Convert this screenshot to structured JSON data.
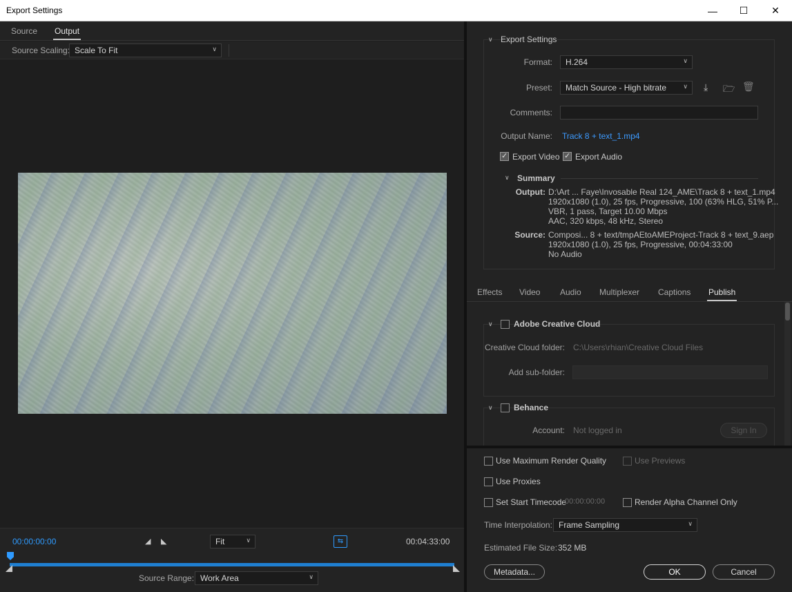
{
  "window": {
    "title": "Export Settings",
    "minimize": "—",
    "maximize": "☐",
    "close": "✕"
  },
  "left": {
    "tabs": [
      {
        "label": "Source"
      },
      {
        "label": "Output"
      }
    ],
    "source_scaling": {
      "label": "Source Scaling:",
      "value": "Scale To Fit"
    },
    "transport": {
      "current_time": "00:00:00:00",
      "end_time": "00:04:33:00",
      "zoom": "Fit",
      "source_range_label": "Source Range:",
      "source_range_value": "Work Area"
    }
  },
  "export_settings": {
    "section_title": "Export Settings",
    "format_label": "Format:",
    "format_value": "H.264",
    "preset_label": "Preset:",
    "preset_value": "Match Source - High bitrate",
    "comments_label": "Comments:",
    "comments_value": "",
    "output_name_label": "Output Name:",
    "output_name_value": "Track 8 + text_1.mp4",
    "export_video_label": "Export Video",
    "export_audio_label": "Export Audio",
    "summary": {
      "title": "Summary",
      "output_label": "Output:",
      "output_lines": [
        "D:\\Art ... Faye\\Invosable Real 124_AME\\Track 8 + text_1.mp4",
        "1920x1080 (1.0), 25 fps, Progressive, 100 (63% HLG, 51% P...",
        "VBR, 1 pass, Target 10.00 Mbps",
        "AAC, 320 kbps, 48 kHz, Stereo"
      ],
      "source_label": "Source:",
      "source_lines": [
        "Composi... 8 + text/tmpAEtoAMEProject-Track 8 + text_9.aep",
        "1920x1080 (1.0), 25 fps, Progressive, 00:04:33:00",
        "No Audio"
      ]
    }
  },
  "settings_tabs": [
    {
      "label": "Effects"
    },
    {
      "label": "Video"
    },
    {
      "label": "Audio"
    },
    {
      "label": "Multiplexer"
    },
    {
      "label": "Captions"
    },
    {
      "label": "Publish"
    }
  ],
  "publish": {
    "creative_cloud": {
      "title": "Adobe Creative Cloud",
      "folder_label": "Creative Cloud folder:",
      "folder_value": "C:\\Users\\rhian\\Creative Cloud Files",
      "subfolder_label": "Add sub-folder:"
    },
    "behance": {
      "title": "Behance",
      "account_label": "Account:",
      "account_value": "Not logged in",
      "sign_in": "Sign In"
    }
  },
  "bottom": {
    "max_render_quality": "Use Maximum Render Quality",
    "use_previews": "Use Previews",
    "use_proxies": "Use Proxies",
    "set_start_timecode": "Set Start Timecode",
    "start_timecode_value": "00:00:00:00",
    "render_alpha": "Render Alpha Channel Only",
    "time_interpolation_label": "Time Interpolation:",
    "time_interpolation_value": "Frame Sampling",
    "file_size_label": "Estimated File Size:",
    "file_size_value": "352 MB",
    "metadata_button": "Metadata...",
    "ok_button": "OK",
    "cancel_button": "Cancel"
  },
  "icons": {
    "save_preset": "download-icon",
    "import_preset": "folder-import-icon",
    "delete_preset": "trash-icon"
  },
  "colors": {
    "accent": "#2f9bff",
    "link": "#3d9bff",
    "panel_bg": "#232323"
  }
}
